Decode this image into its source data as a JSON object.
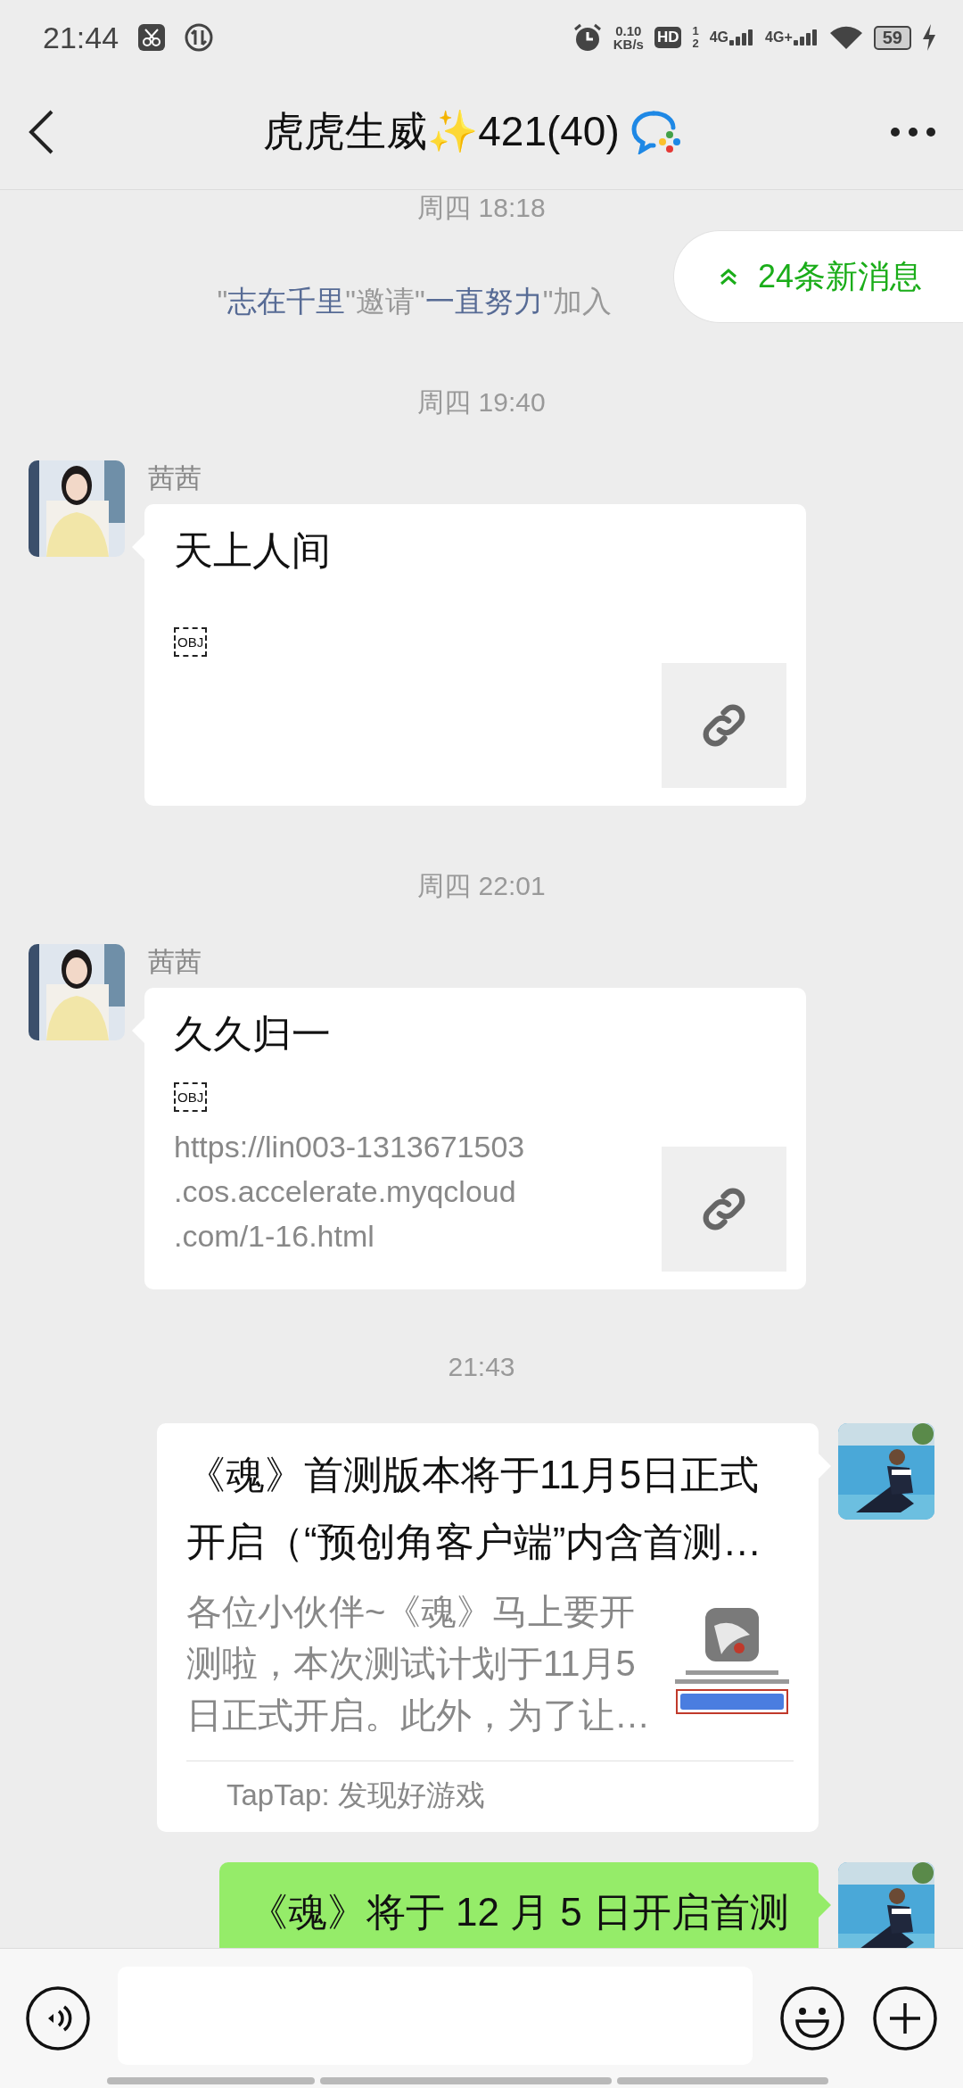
{
  "status_bar": {
    "time": "21:44",
    "net_speed": "0.10",
    "net_unit": "KB/s",
    "hd": "HD",
    "sim_1": "1",
    "sim_2": "2",
    "network_1": "4G",
    "network_2": "4G+",
    "battery": "59"
  },
  "header": {
    "title": "虎虎生威✨421(40)"
  },
  "new_messages": {
    "label": "24条新消息"
  },
  "messages": [
    {
      "kind": "time",
      "text": "周四 18:18"
    },
    {
      "kind": "system",
      "parts": [
        {
          "text": "\"",
          "link": false
        },
        {
          "text": "志在千里",
          "link": true
        },
        {
          "text": "\"邀请\"",
          "link": false
        },
        {
          "text": "一直努力",
          "link": true
        },
        {
          "text": "\"加入",
          "link": false
        }
      ]
    },
    {
      "kind": "time",
      "text": "周四 19:40"
    },
    {
      "kind": "link",
      "outgoing": false,
      "sender": "茜茜",
      "title": "天上人间",
      "obj": "OBJ"
    },
    {
      "kind": "time",
      "text": "周四 22:01"
    },
    {
      "kind": "link",
      "outgoing": false,
      "sender": "茜茜",
      "title": "久久归一",
      "obj": "OBJ",
      "url_lines": [
        "https://lin003-1313671503",
        ".cos.accelerate.myqcloud",
        ".com/1-16.html"
      ]
    },
    {
      "kind": "time",
      "text": "21:43"
    },
    {
      "kind": "article",
      "outgoing": true,
      "title_lines": [
        "《魂》首测版本将于11月5日正式",
        "开启（“预创角客户端”内含首测…"
      ],
      "description_lines": [
        "各位小伙伴~《魂》马上要开",
        "测啦，本次测试计划于11月5",
        "日正式开启。此外，为了让…"
      ],
      "source": "TapTap: 发现好游戏"
    },
    {
      "kind": "text",
      "outgoing": true,
      "text": "《魂》将于 12 月 5 日开启首测"
    }
  ]
}
